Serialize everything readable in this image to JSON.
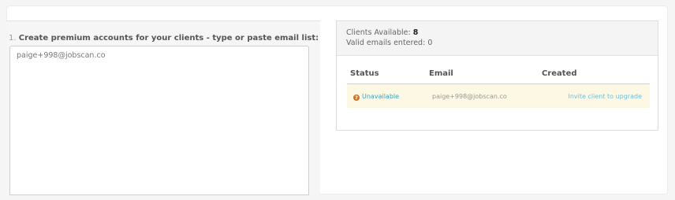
{
  "form": {
    "step_number": "1.",
    "step_label": "Create premium accounts for your clients - type or paste email list:",
    "email_list_value": "paige+998@jobscan.co"
  },
  "summary": {
    "clients_available_label": "Clients Available:",
    "clients_available_value": "8",
    "valid_emails_label": "Valid emails entered:",
    "valid_emails_value": "0"
  },
  "table": {
    "columns": [
      "Status",
      "Email",
      "Created"
    ],
    "rows": [
      {
        "status_icon": "question-circle-icon",
        "status": "Unavailable",
        "email": "paige+998@jobscan.co",
        "action": "Invite client to upgrade"
      }
    ]
  },
  "colors": {
    "status_link": "#31a5c9",
    "warning_row": "#fcf8e3",
    "question_icon": "#c9762b"
  }
}
